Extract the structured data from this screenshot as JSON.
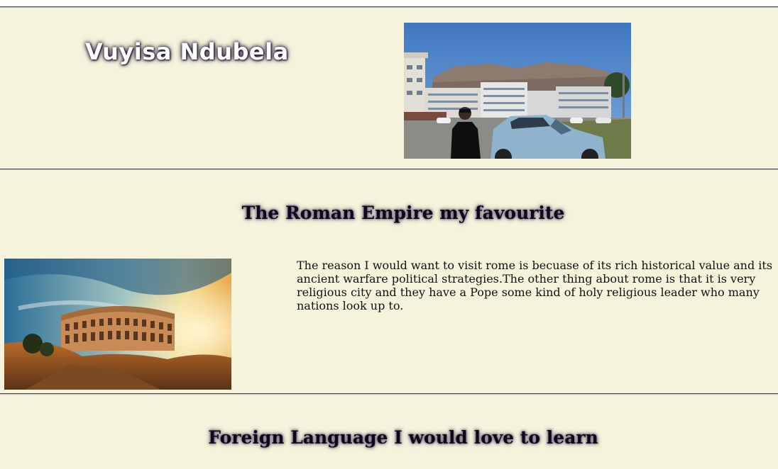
{
  "header": {
    "name": "Vuyisa Ndubela"
  },
  "sections": [
    {
      "heading": "The Roman Empire my favourite",
      "paragraph": "The reason I would want to visit rome is becuase of its rich historical value and its ancient warfare political strategies.The other thing about rome is that it is very religious city and they have a Pope some kind of holy religious leader who many nations look up to."
    },
    {
      "heading": "Foreign Language I would love to learn"
    }
  ]
}
